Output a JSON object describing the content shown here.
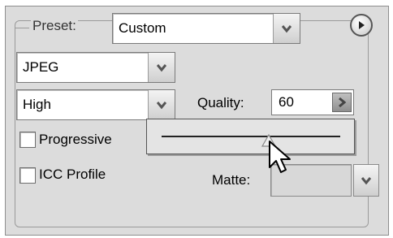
{
  "preset": {
    "label": "Preset:",
    "value": "Custom"
  },
  "format": {
    "value": "JPEG"
  },
  "quality_level": {
    "value": "High"
  },
  "quality": {
    "label": "Quality:",
    "value": "60",
    "slider_fraction": 0.6
  },
  "progressive": {
    "label": "Progressive",
    "checked": false
  },
  "icc_profile": {
    "label": "ICC Profile",
    "checked": false
  },
  "matte": {
    "label": "Matte:",
    "value": ""
  },
  "icons": {
    "menu": "play-circle-icon",
    "dropdown": "chevron-down-icon",
    "quality_arrow": "chevron-right-icon",
    "cursor": "arrow-cursor-icon",
    "slider_thumb": "triangle-thumb-icon"
  }
}
